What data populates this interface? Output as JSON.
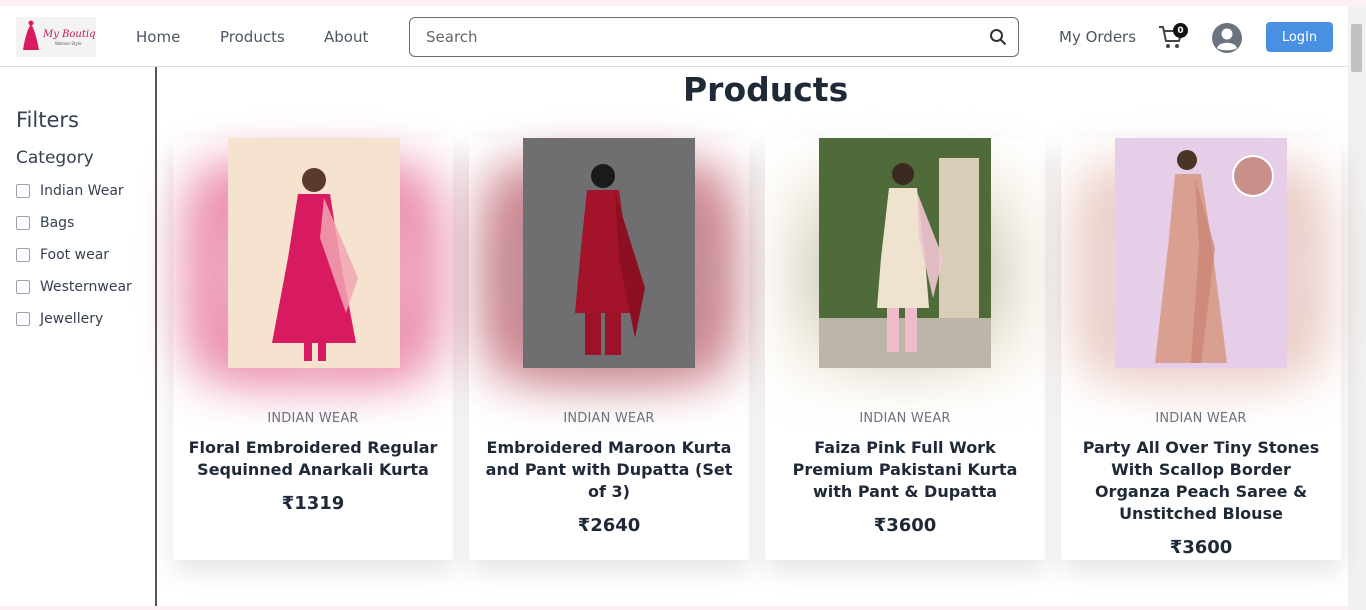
{
  "nav": {
    "brand": "My Boutique",
    "brand_tagline": "Women Style",
    "links": [
      "Home",
      "Products",
      "About"
    ],
    "search_placeholder": "Search",
    "orders_label": "My Orders",
    "cart_count": "0",
    "login_label": "LogIn"
  },
  "sidebar": {
    "title": "Filters",
    "category_title": "Category",
    "categories": [
      "Indian Wear",
      "Bags",
      "Foot wear",
      "Westernwear",
      "Jewellery"
    ]
  },
  "main": {
    "title": "Products",
    "products": [
      {
        "category": "INDIAN WEAR",
        "name": "Floral Embroidered Regular Sequinned Anarkali Kurta",
        "price": "₹1319",
        "color": "#d81b60",
        "bg": "#f6e3cf"
      },
      {
        "category": "INDIAN WEAR",
        "name": "Embroidered Maroon Kurta and Pant with Dupatta (Set of 3)",
        "price": "₹2640",
        "color": "#a3142b",
        "bg": "#6f6f72"
      },
      {
        "category": "INDIAN WEAR",
        "name": "Faiza Pink Full Work Premium Pakistani Kurta with Pant & Dupatta",
        "price": "₹3600",
        "color": "#efe3d0",
        "bg": "#4f6b3a"
      },
      {
        "category": "INDIAN WEAR",
        "name": "Party All Over Tiny Stones With Scallop Border Organza Peach Saree & Unstitched Blouse",
        "price": "₹3600",
        "color": "#d9a092",
        "bg": "#e6cde8"
      }
    ]
  },
  "colors": {
    "accent": "#4a90e2",
    "divider": "#555555"
  },
  "icons": [
    "search-icon",
    "cart-icon",
    "user-avatar-icon"
  ]
}
